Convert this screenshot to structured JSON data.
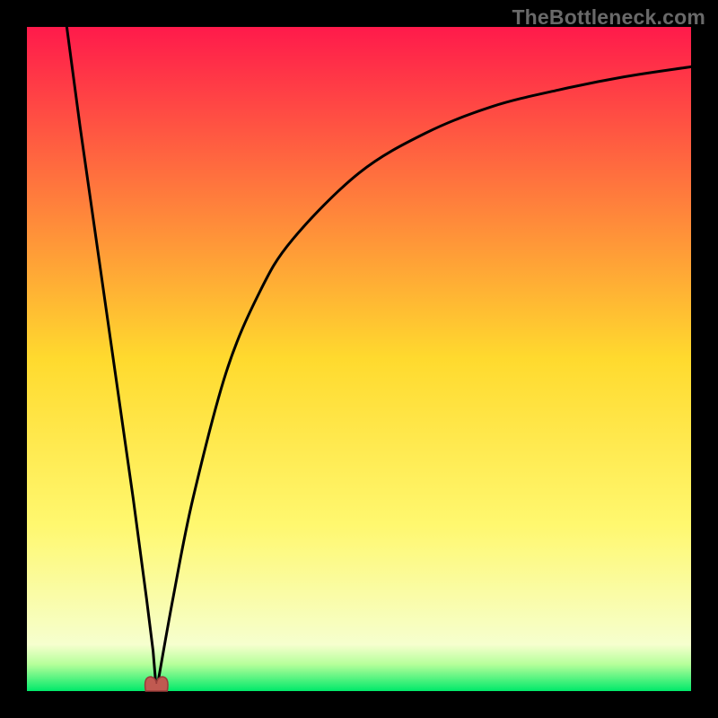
{
  "watermark": "TheBottleneck.com",
  "chart_data": {
    "type": "line",
    "title": "",
    "xlabel": "",
    "ylabel": "",
    "x_range": [
      0,
      1
    ],
    "y_range": [
      0,
      100
    ],
    "notch_x": 0.195,
    "series": [
      {
        "name": "left-branch",
        "x": [
          0.06,
          0.08,
          0.1,
          0.12,
          0.14,
          0.16,
          0.18,
          0.19,
          0.195
        ],
        "y": [
          100,
          85,
          71,
          57,
          43,
          29,
          14,
          6,
          0
        ]
      },
      {
        "name": "right-branch",
        "x": [
          0.195,
          0.22,
          0.25,
          0.3,
          0.35,
          0.4,
          0.5,
          0.6,
          0.7,
          0.8,
          0.9,
          1.0
        ],
        "y": [
          0,
          14,
          29,
          48,
          60,
          68,
          78,
          84,
          88,
          90.5,
          92.5,
          94
        ]
      }
    ],
    "gradient_stops": [
      {
        "pct": 0,
        "color": "#ff1a4b"
      },
      {
        "pct": 50,
        "color": "#ffda2e"
      },
      {
        "pct": 75,
        "color": "#fff86f"
      },
      {
        "pct": 93,
        "color": "#f6ffce"
      },
      {
        "pct": 96,
        "color": "#b5ff9a"
      },
      {
        "pct": 100,
        "color": "#00e96a"
      }
    ],
    "marker": {
      "color": "#c05a51",
      "outline": "#9a3c3a"
    }
  }
}
